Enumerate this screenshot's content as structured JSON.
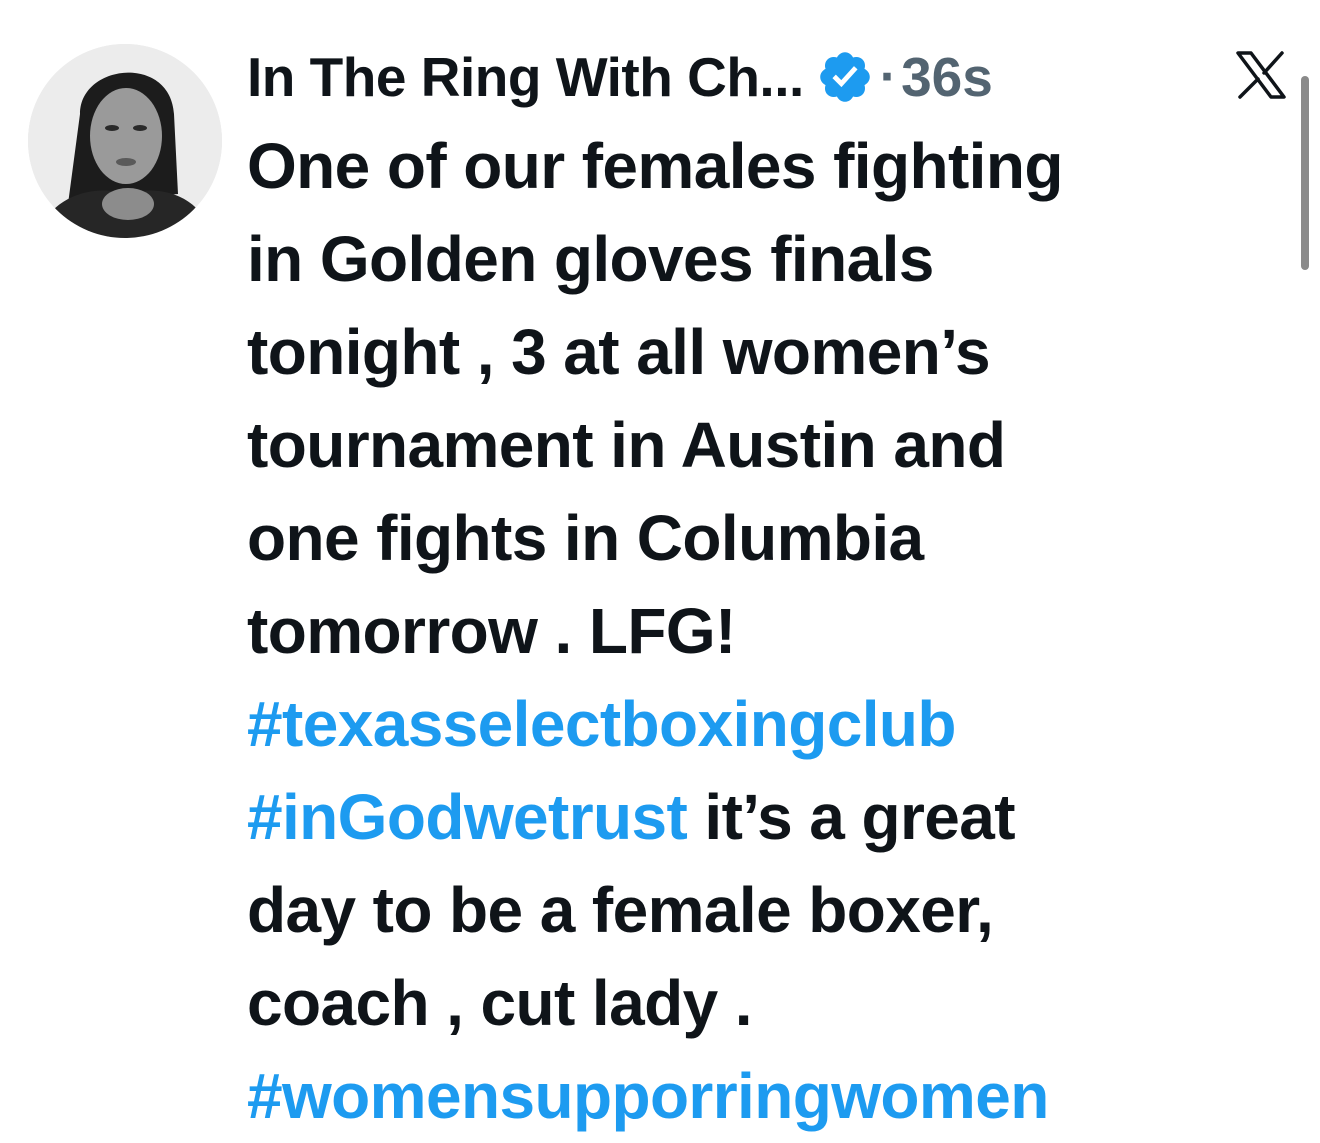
{
  "tweet": {
    "author_name": "In The Ring With Ch...",
    "separator": "·",
    "time": "36s",
    "lines": [
      [
        {
          "text": "One of our females fighting",
          "type": "text"
        }
      ],
      [
        {
          "text": "in Golden gloves finals",
          "type": "text"
        }
      ],
      [
        {
          "text": "tonight , 3 at all women’s",
          "type": "text"
        }
      ],
      [
        {
          "text": "tournament in Austin and",
          "type": "text"
        }
      ],
      [
        {
          "text": "one fights in Columbia",
          "type": "text"
        }
      ],
      [
        {
          "text": "tomorrow . LFG!",
          "type": "text"
        }
      ],
      [
        {
          "text": "#texasselectboxingclub",
          "type": "hashtag"
        }
      ],
      [
        {
          "text": "#inGodwetrust",
          "type": "hashtag"
        },
        {
          "text": " it’s a great",
          "type": "text"
        }
      ],
      [
        {
          "text": "day to be a female boxer,",
          "type": "text"
        }
      ],
      [
        {
          "text": "coach , cut lady .",
          "type": "text"
        }
      ],
      [
        {
          "text": "#womensupporringwomen",
          "type": "hashtag"
        }
      ]
    ]
  },
  "icons": {
    "verified": "verified-badge-icon",
    "platform": "x-logo-icon"
  },
  "colors": {
    "text": "#0f1419",
    "muted": "#536471",
    "accent": "#1d9bf0"
  }
}
